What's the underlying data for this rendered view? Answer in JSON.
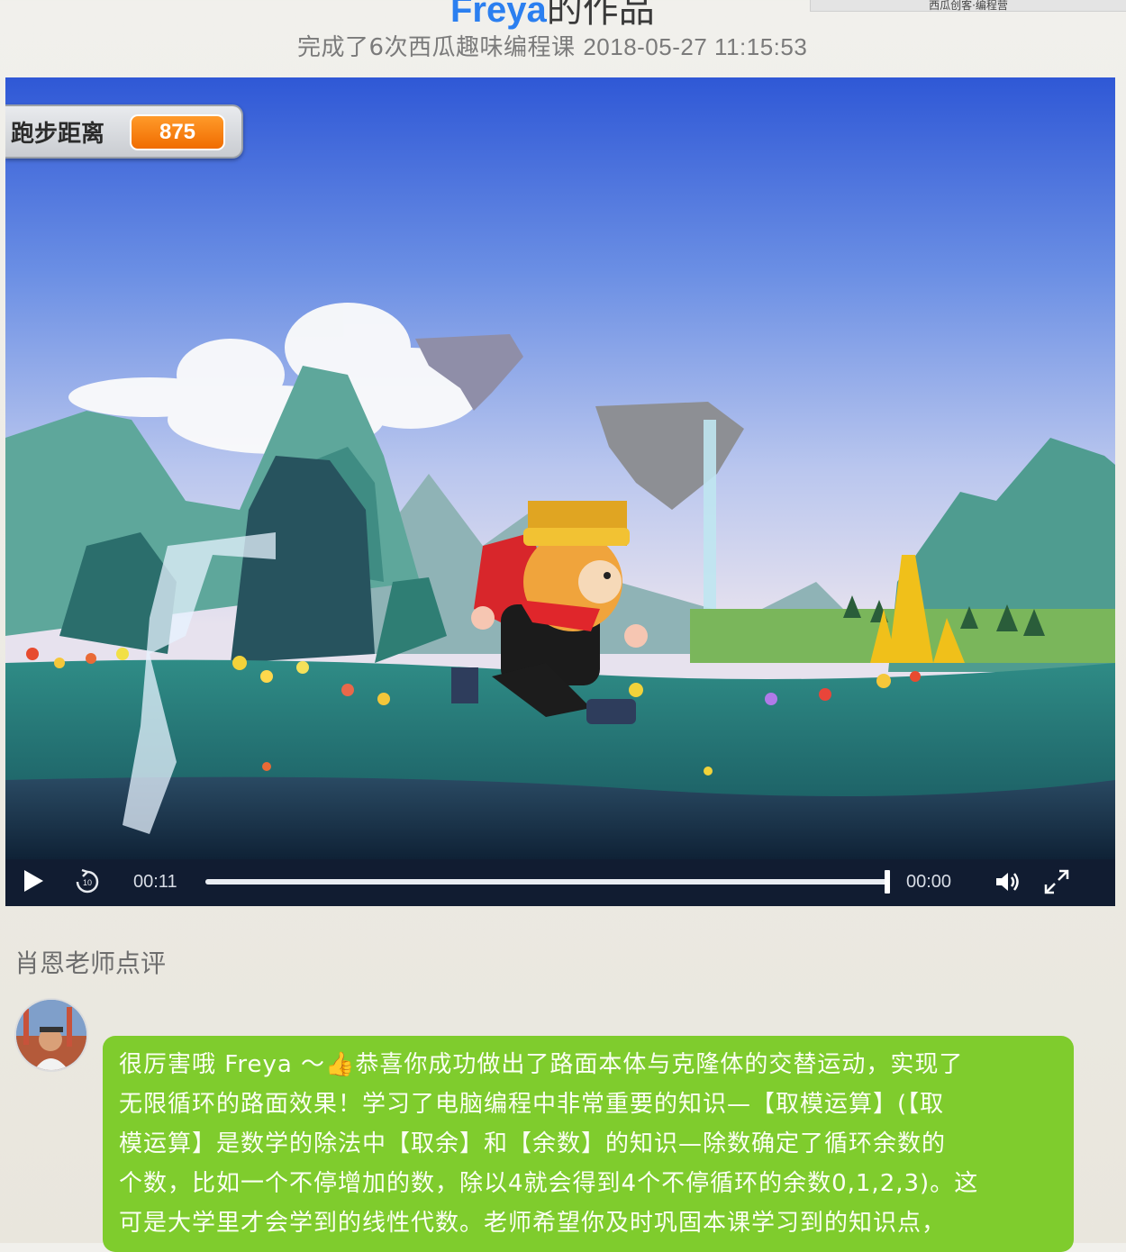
{
  "header": {
    "title_name": "Freya",
    "title_suffix": "的作品",
    "subtitle_text": "完成了6次西瓜趣味编程课",
    "subtitle_date": "2018-05-27 11:15:53",
    "top_tab_label": "西瓜创客·编程营"
  },
  "player": {
    "score_label": "跑步距离",
    "score_value": "875",
    "time_current": "00:11",
    "time_total": "00:00",
    "progress_fraction": 1.0,
    "icons": [
      "play-icon",
      "replay-10-icon",
      "volume-icon",
      "fullscreen-icon"
    ]
  },
  "comment": {
    "heading": "肖恩老师点评",
    "lines": [
      "很厉害哦 Freya ～",
      "恭喜你成功做出了路面本体与克隆体的交替运动，实现了",
      "无限循环的路面效果！学习了电脑编程中非常重要的知识—【取模运算】(【取",
      "模运算】是数学的除法中【取余】和【余数】的知识—除数确定了循环余数的",
      "个数，比如一个不停增加的数，除以4就会得到4个不停循环的余数0,1,2,3)。这",
      "可是大学里才会学到的线性代数。老师希望你及时巩固本课学习到的知识点，"
    ],
    "emoji": "👍"
  },
  "colors": {
    "title_blue": "#2b7ff0",
    "bubble_green": "#7fcc2d",
    "score_orange": "#f07a10",
    "player_bg": "#0f1c33"
  }
}
